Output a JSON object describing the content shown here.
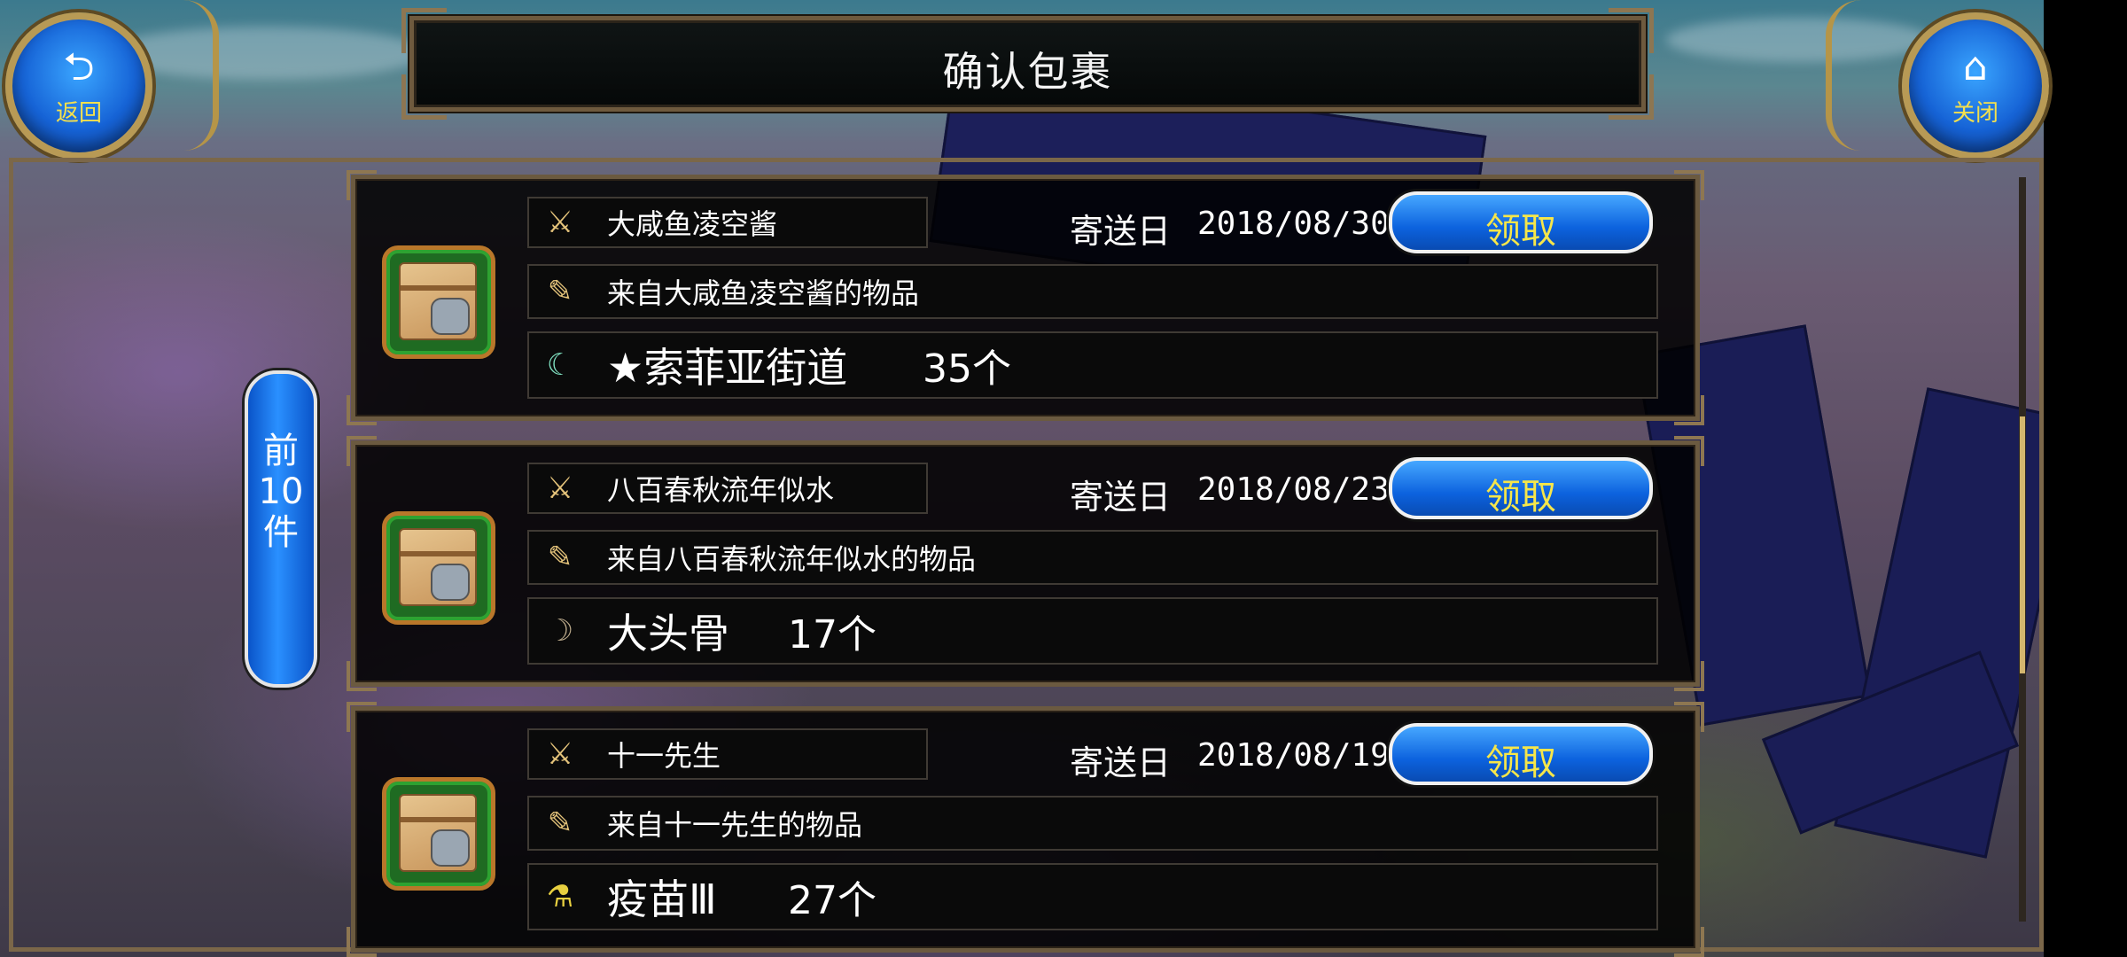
{
  "header": {
    "title": "确认包裹",
    "back_label": "返回",
    "close_label": "关闭"
  },
  "nav": {
    "prev_label": "前\n10\n件"
  },
  "mails": [
    {
      "sender": "大咸鱼凌空酱",
      "date_label": "寄送日",
      "date": "2018/08/30",
      "from_text": "来自大咸鱼凌空酱的物品",
      "item_name": "★索菲亚街道",
      "quantity": "35个",
      "item_icon": "crescent-blade-icon",
      "claim_label": "领取"
    },
    {
      "sender": "八百春秋流年似水",
      "date_label": "寄送日",
      "date": "2018/08/23",
      "from_text": "来自八百春秋流年似水的物品",
      "item_name": "大头骨",
      "quantity": "17个",
      "item_icon": "bone-icon",
      "claim_label": "领取"
    },
    {
      "sender": "十一先生",
      "date_label": "寄送日",
      "date": "2018/08/19",
      "from_text": "来自十一先生的物品",
      "item_name": "疫苗Ⅲ",
      "quantity": "27个",
      "item_icon": "potion-icon",
      "claim_label": "领取"
    }
  ],
  "colors": {
    "accent_blue": "#1663d6",
    "gold": "#b89a55",
    "claim_text": "#f6e64a"
  }
}
